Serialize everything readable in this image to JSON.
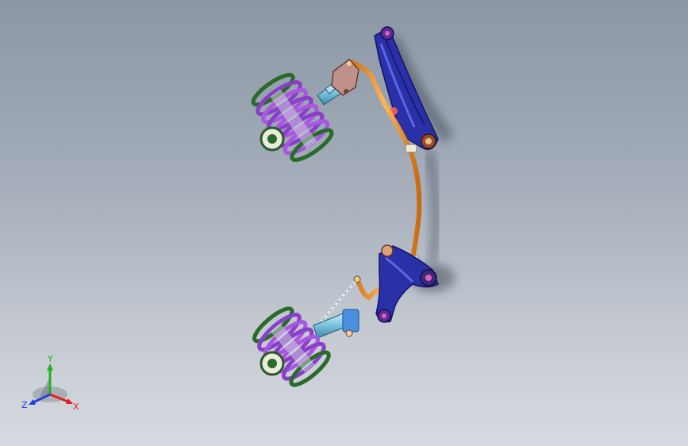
{
  "viewport": {
    "background_top": "#8b97a5",
    "background_bottom": "#d7dae0"
  },
  "model": {
    "parts": [
      "upper-coil-spring",
      "upper-strut",
      "upper-steering-knuckle",
      "upper-control-arm",
      "stabilizer-bar",
      "lower-control-arm",
      "tie-rod",
      "lower-strut",
      "lower-coil-spring"
    ],
    "colors": {
      "spring": "#8a3fc8",
      "strut": "#7fc7e0",
      "control_arm": "#2a30a8",
      "stabilizer_bar": "#f0a040",
      "hub": "#3a7a3a"
    }
  },
  "triad": {
    "x_label": "X",
    "y_label": "Y",
    "z_label": "Z",
    "x_color": "#e02020",
    "y_color": "#20b020",
    "z_color": "#2040e0"
  }
}
